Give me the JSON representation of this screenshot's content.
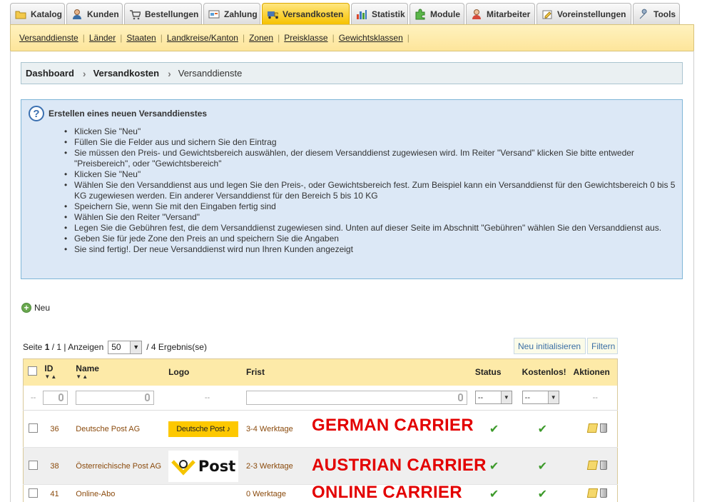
{
  "tabs": [
    {
      "label": "Katalog",
      "icon": "folder-icon"
    },
    {
      "label": "Kunden",
      "icon": "user-icon"
    },
    {
      "label": "Bestellungen",
      "icon": "cart-icon"
    },
    {
      "label": "Zahlung",
      "icon": "payment-icon"
    },
    {
      "label": "Versandkosten",
      "icon": "truck-icon",
      "active": true
    },
    {
      "label": "Statistik",
      "icon": "chart-icon"
    },
    {
      "label": "Module",
      "icon": "puzzle-icon"
    },
    {
      "label": "Mitarbeiter",
      "icon": "employee-icon"
    },
    {
      "label": "Voreinstellungen",
      "icon": "preferences-icon"
    },
    {
      "label": "Tools",
      "icon": "wrench-icon"
    }
  ],
  "subnav": [
    "Versanddienste",
    "Länder",
    "Staaten",
    "Landkreise/Kanton",
    "Zonen",
    "Preisklasse",
    "Gewichtsklassen"
  ],
  "breadcrumb": {
    "root": "Dashboard",
    "section": "Versandkosten",
    "current": "Versanddienste"
  },
  "hint": {
    "title": "Erstellen eines neuen Versanddienstes",
    "items": [
      "Klicken Sie \"Neu\"",
      "Füllen Sie die Felder aus und sichern Sie den Eintrag",
      "Sie müssen den Preis- und Gewichtsbereich auswählen, der diesem Versanddienst zugewiesen wird. Im Reiter \"Versand\" klicken Sie bitte entweder \"Preisbereich\", oder \"Gewichtsbereich\"",
      "Klicken Sie \"Neu\"",
      "Wählen Sie den Versanddienst aus und legen Sie den Preis-, oder Gewichtsbereich fest. Zum Beispiel kann ein Versanddienst für den Gewichtsbereich 0 bis 5 KG zugewiesen werden. Ein anderer Versanddienst für den Bereich 5 bis 10 KG",
      "Speichern Sie, wenn Sie mit den Eingaben fertig sind",
      "Wählen Sie den Reiter \"Versand\"",
      "Legen Sie die Gebühren fest, die dem Versanddienst zugewiesen sind. Unten auf dieser Seite im Abschnitt \"Gebühren\" wählen Sie den Versanddienst aus.",
      "Geben Sie für jede Zone den Preis an und speichern Sie die Angaben",
      "Sie sind fertig!. Der neue Versanddienst wird nun Ihren Kunden angezeigt"
    ]
  },
  "new_label": "Neu",
  "pager": {
    "prefix": "Seite",
    "page": "1",
    "of": "/ 1 | Anzeigen",
    "per_page": "50",
    "results": "/ 4 Ergebnis(se)"
  },
  "buttons": {
    "reset": "Neu initialisieren",
    "filter": "Filtern"
  },
  "columns": {
    "id": "ID",
    "name": "Name",
    "logo": "Logo",
    "delay": "Frist",
    "status": "Status",
    "free": "Kostenlos!",
    "actions": "Aktionen"
  },
  "filters": {
    "placeholder_dash": "--",
    "status": "--",
    "free": "--"
  },
  "rows": [
    {
      "id": "36",
      "name": "Deutsche Post AG",
      "logo_text": "Deutsche Post",
      "delay": "3-4 Werktage",
      "annotation": "GERMAN CARRIER"
    },
    {
      "id": "38",
      "name": "Österreichische Post AG",
      "logo_text": "Post",
      "delay": "2-3 Werktage",
      "annotation": "AUSTRIAN CARRIER"
    },
    {
      "id": "41",
      "name": "Online-Abo",
      "logo_text": "",
      "delay": "0 Werktage",
      "annotation": "ONLINE CARRIER"
    }
  ],
  "check_glyph": "✔"
}
